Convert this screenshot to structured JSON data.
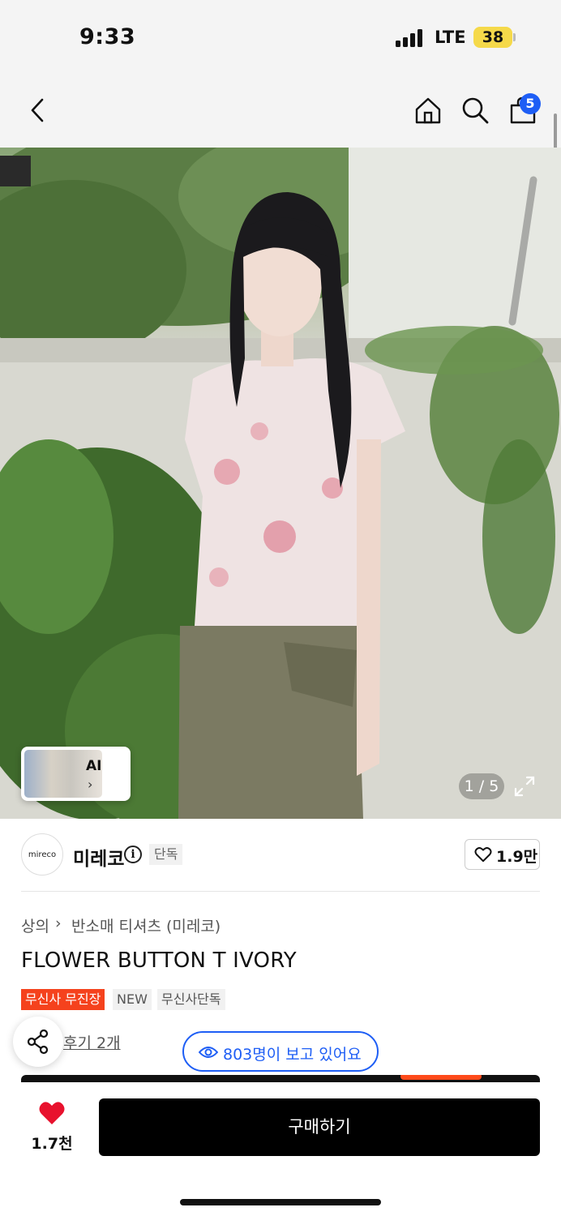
{
  "status_bar": {
    "time": "9:33",
    "network": "LTE",
    "battery": "38"
  },
  "nav": {
    "cart_count": "5"
  },
  "hero": {
    "counter": "1 / 5",
    "ai_label": "AI",
    "ai_chevron": "›"
  },
  "brand": {
    "logo_text": "mireco",
    "name": "미레코",
    "info_glyph": "i",
    "exclusive_tag": "단독",
    "likes": "1.9만"
  },
  "breadcrumb": {
    "category": "상의",
    "separator": "›",
    "subcategory": "반소매 티셔츠 (미레코)"
  },
  "product": {
    "title": "FLOWER BUTTON T IVORY",
    "tags": [
      "무신사 무진장",
      "NEW",
      "무신사단독"
    ],
    "review_link": "후기 2개"
  },
  "viewers": {
    "text": "803명이 보고 있어요"
  },
  "bottom_bar": {
    "likes": "1.7천",
    "buy_label": "구매하기"
  },
  "colors": {
    "accent_blue": "#1e5ef5",
    "tag_red": "#f5421d",
    "heart_red": "#e8112d",
    "battery_yellow": "#f5d94a"
  }
}
